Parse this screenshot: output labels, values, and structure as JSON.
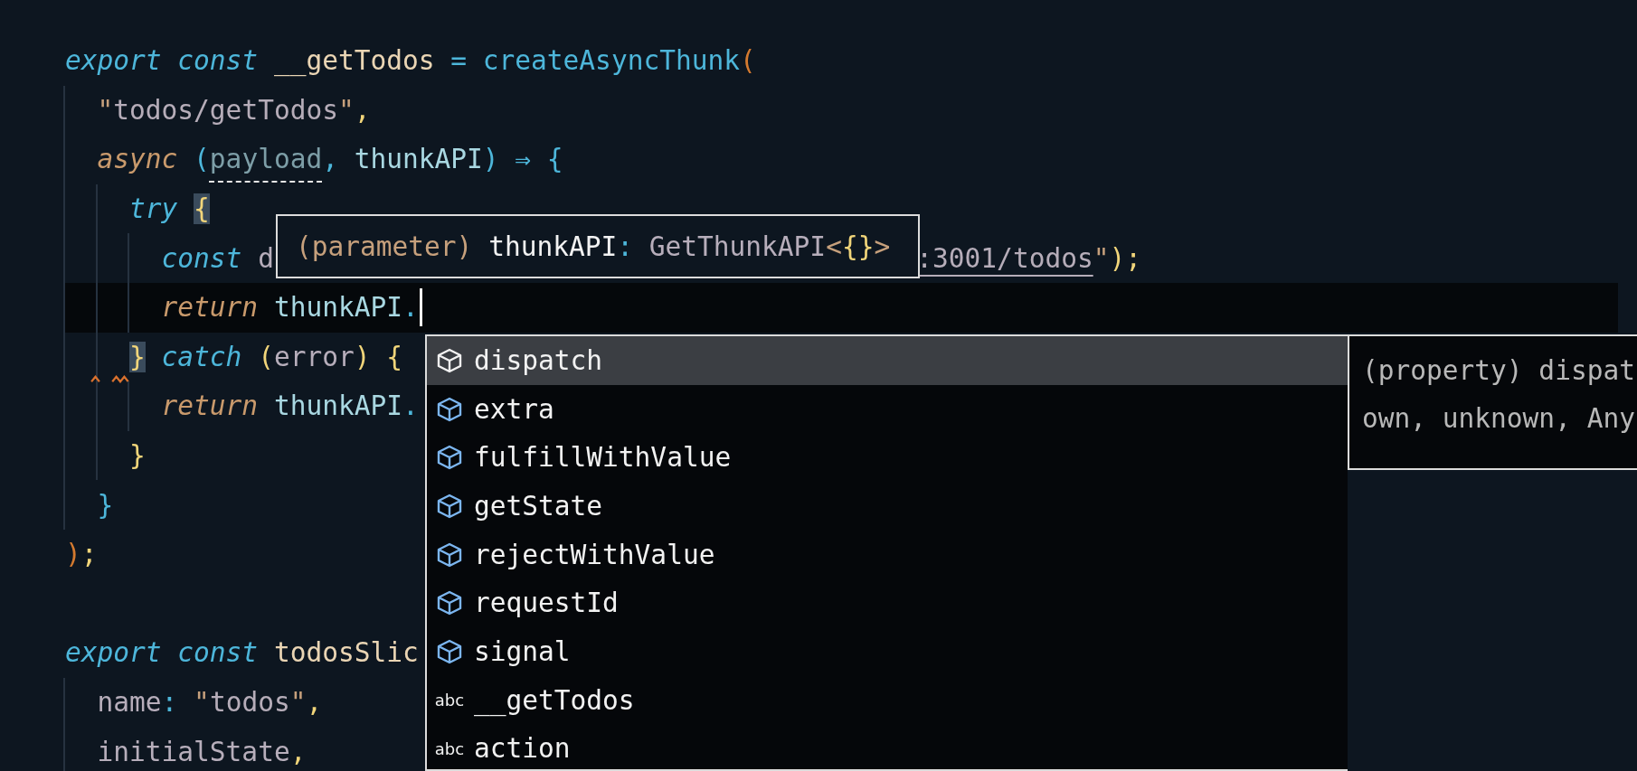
{
  "editor": {
    "lines": [
      {
        "kind": "code",
        "current": false,
        "warning": false,
        "tokens": [
          {
            "text": "export const ",
            "kind": "keyword"
          },
          {
            "text": "__getTodos",
            "kind": "declaration"
          },
          {
            "text": " = ",
            "kind": "operator"
          },
          {
            "text": "createAsyncThunk",
            "kind": "function"
          },
          {
            "text": "(",
            "kind": "paren"
          }
        ]
      },
      {
        "kind": "code",
        "current": false,
        "warning": false,
        "tokens": [
          {
            "text": "  \"",
            "kind": "quote"
          },
          {
            "text": "todos/getTodos",
            "kind": "string"
          },
          {
            "text": "\"",
            "kind": "quote"
          },
          {
            "text": ",",
            "kind": "punct"
          }
        ]
      },
      {
        "kind": "code",
        "current": false,
        "warning": false,
        "tokens": [
          {
            "text": "  async",
            "kind": "keyword2"
          },
          {
            "text": " (",
            "kind": "operator"
          },
          {
            "text": "payload",
            "kind": "unused"
          },
          {
            "text": ", ",
            "kind": "operator"
          },
          {
            "text": "thunkAPI",
            "kind": "ident"
          },
          {
            "text": ") ⇒ {",
            "kind": "operator"
          }
        ]
      },
      {
        "kind": "code",
        "current": false,
        "warning": false,
        "tokens": [
          {
            "text": "    try ",
            "kind": "keyword"
          },
          {
            "text": "{",
            "kind": "match"
          }
        ]
      },
      {
        "kind": "code",
        "current": false,
        "warning": false,
        "tokens": [
          {
            "text": "      const",
            "kind": "keyword"
          },
          {
            "text": " d",
            "kind": "plain"
          }
        ],
        "after_tooltip": [
          {
            "text": ":3001/todos",
            "kind": "link"
          },
          {
            "text": "\"",
            "kind": "quote"
          },
          {
            "text": ");",
            "kind": "punct"
          }
        ]
      },
      {
        "kind": "code",
        "current": true,
        "warning": false,
        "tokens": [
          {
            "text": "      return",
            "kind": "keyword2"
          },
          {
            "text": " thunkAPI",
            "kind": "ident"
          },
          {
            "text": ".",
            "kind": "operator"
          }
        ]
      },
      {
        "kind": "code",
        "current": false,
        "warning": true,
        "tokens": [
          {
            "text": "    }",
            "kind": "match"
          },
          {
            "text": " catch",
            "kind": "keyword"
          },
          {
            "text": " (",
            "kind": "punct"
          },
          {
            "text": "error",
            "kind": "plain"
          },
          {
            "text": ") {",
            "kind": "punct"
          }
        ]
      },
      {
        "kind": "code",
        "current": false,
        "warning": false,
        "tokens": [
          {
            "text": "      return",
            "kind": "keyword2"
          },
          {
            "text": " thunkAPI",
            "kind": "ident"
          },
          {
            "text": ".",
            "kind": "operator"
          }
        ]
      },
      {
        "kind": "code",
        "current": false,
        "warning": false,
        "tokens": [
          {
            "text": "    }",
            "kind": "punct"
          }
        ]
      },
      {
        "kind": "code",
        "current": false,
        "warning": false,
        "tokens": [
          {
            "text": "  }",
            "kind": "operator"
          }
        ]
      },
      {
        "kind": "code",
        "current": false,
        "warning": false,
        "tokens": [
          {
            "text": ")",
            "kind": "paren"
          },
          {
            "text": ";",
            "kind": "punct"
          }
        ]
      },
      {
        "kind": "blank"
      },
      {
        "kind": "code",
        "current": false,
        "warning": false,
        "tokens": [
          {
            "text": "export const ",
            "kind": "keyword"
          },
          {
            "text": "todosSlic",
            "kind": "declaration"
          }
        ]
      },
      {
        "kind": "code",
        "current": false,
        "warning": false,
        "tokens": [
          {
            "text": "  name",
            "kind": "plain"
          },
          {
            "text": ": ",
            "kind": "operator"
          },
          {
            "text": "\"",
            "kind": "quote"
          },
          {
            "text": "todos",
            "kind": "string"
          },
          {
            "text": "\"",
            "kind": "quote"
          },
          {
            "text": ",",
            "kind": "punct"
          }
        ]
      },
      {
        "kind": "code",
        "current": false,
        "warning": false,
        "tokens": [
          {
            "text": "  initialState",
            "kind": "plain"
          },
          {
            "text": ",",
            "kind": "punct"
          }
        ]
      }
    ]
  },
  "hover_tooltip": {
    "tokens": [
      {
        "text": "(parameter)",
        "kind": "quote"
      },
      {
        "text": " thunkAPI",
        "kind": "bright"
      },
      {
        "text": ": ",
        "kind": "operator"
      },
      {
        "text": "GetThunkAPI",
        "kind": "plain"
      },
      {
        "text": "<",
        "kind": "quote"
      },
      {
        "text": "{}",
        "kind": "punct"
      },
      {
        "text": ">",
        "kind": "quote"
      }
    ]
  },
  "suggestions": [
    {
      "label": "dispatch",
      "kind": "property",
      "selected": true
    },
    {
      "label": "extra",
      "kind": "property",
      "selected": false
    },
    {
      "label": "fulfillWithValue",
      "kind": "property",
      "selected": false
    },
    {
      "label": "getState",
      "kind": "property",
      "selected": false
    },
    {
      "label": "rejectWithValue",
      "kind": "property",
      "selected": false
    },
    {
      "label": "requestId",
      "kind": "property",
      "selected": false
    },
    {
      "label": "signal",
      "kind": "property",
      "selected": false
    },
    {
      "label": "__getTodos",
      "kind": "text",
      "icon_text": "abc",
      "selected": false
    },
    {
      "label": "action",
      "kind": "text",
      "icon_text": "abc",
      "selected": false
    }
  ],
  "suggestion_details": {
    "lines": [
      "(property) dispat",
      "own, unknown, Any"
    ]
  }
}
